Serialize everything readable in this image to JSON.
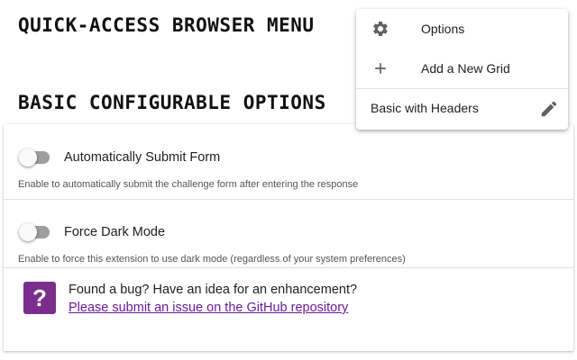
{
  "page": {
    "heading_quick": "QUICK-ACCESS BROWSER MENU",
    "heading_basic": "BASIC CONFIGURABLE OPTIONS"
  },
  "settings": [
    {
      "title": "Automatically Submit Form",
      "description": "Enable to automatically submit the challenge form after entering the response",
      "enabled": false
    },
    {
      "title": "Force Dark Mode",
      "description": "Enable to force this extension to use dark mode (regardless of your system preferences)",
      "enabled": false
    }
  ],
  "feedback": {
    "icon_glyph": "?",
    "icon_name": "help-icon",
    "text": "Found a bug? Have an idea for an enhancement?",
    "link_text": "Please submit an issue on the GitHub repository"
  },
  "menu": {
    "items": [
      {
        "label": "Options",
        "icon": "gear-icon"
      },
      {
        "label": "Add a New Grid",
        "icon": "plus-icon"
      }
    ],
    "layout_label": "Basic with Headers",
    "layout_icon": "pencil-icon"
  },
  "colors": {
    "accent_purple": "#7b2d8e",
    "link_purple": "#6a1b9a",
    "toggle_track_off": "#9e9e9e",
    "icon_gray": "#616161"
  }
}
